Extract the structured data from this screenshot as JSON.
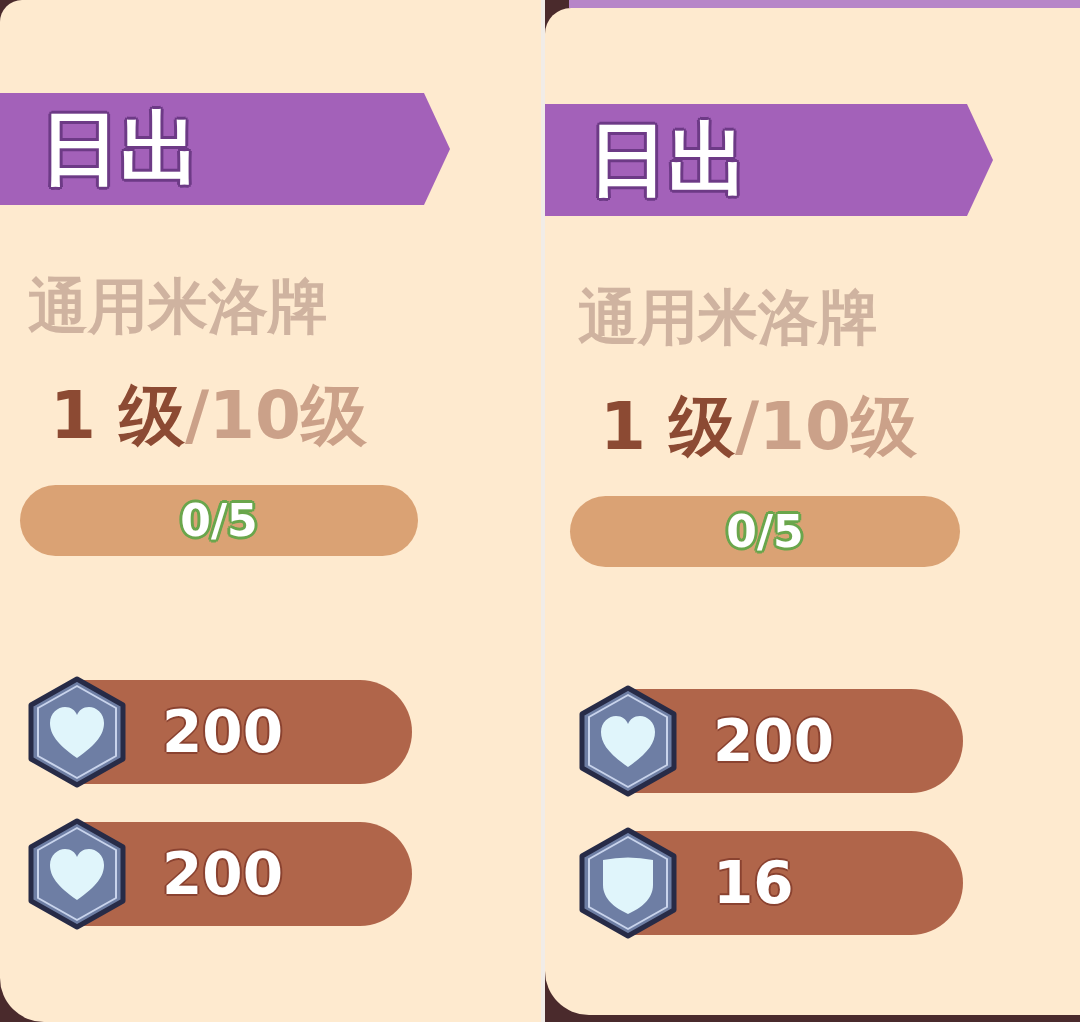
{
  "panels": [
    {
      "title": "日出",
      "subtitle": "通用米洛牌",
      "level_current": "1 级",
      "level_max": "/10级",
      "progress": {
        "text": "0/5",
        "level": 0
      },
      "stats": [
        {
          "kind": "heart",
          "value": "200"
        },
        {
          "kind": "heart",
          "value": "200"
        }
      ]
    },
    {
      "title": "日出",
      "subtitle": "通用米洛牌",
      "level_current": "1 级",
      "level_max": "/10级",
      "progress": {
        "text": "0/5",
        "level": 0
      },
      "stats": [
        {
          "kind": "heart",
          "value": "200"
        },
        {
          "kind": "shield",
          "value": "16"
        }
      ]
    }
  ]
}
